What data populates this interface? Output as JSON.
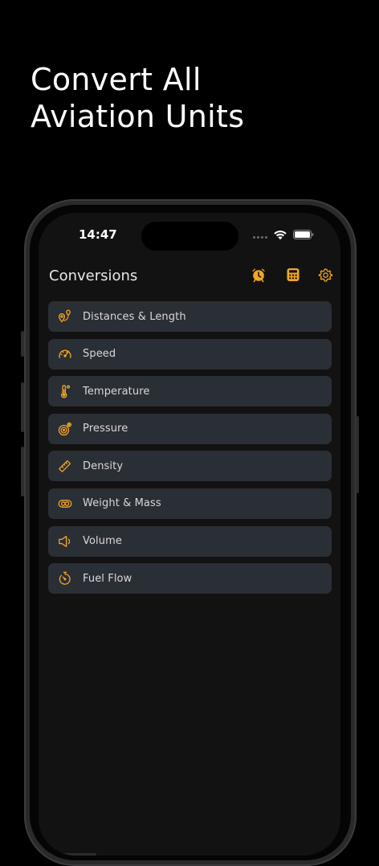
{
  "promo": {
    "headline_line1": "Convert All",
    "headline_line2": "Aviation Units"
  },
  "status_bar": {
    "time": "14:47",
    "icons": [
      "cellular-dots-icon",
      "wifi-icon",
      "battery-icon"
    ]
  },
  "nav": {
    "title": "Conversions",
    "actions": [
      {
        "name": "alarm-clock-icon"
      },
      {
        "name": "calculator-icon"
      },
      {
        "name": "gear-icon"
      }
    ]
  },
  "conversions": [
    {
      "label": "Distances & Length",
      "icon": "route-pin-icon"
    },
    {
      "label": "Speed",
      "icon": "speedometer-icon"
    },
    {
      "label": "Temperature",
      "icon": "thermometer-icon"
    },
    {
      "label": "Pressure",
      "icon": "pressure-gauge-icon"
    },
    {
      "label": "Density",
      "icon": "ruler-icon"
    },
    {
      "label": "Weight & Mass",
      "icon": "weight-coins-icon"
    },
    {
      "label": "Volume",
      "icon": "speaker-volume-icon"
    },
    {
      "label": "Fuel Flow",
      "icon": "stopwatch-icon"
    }
  ],
  "colors": {
    "accent": "#f5a623",
    "row_background": "#2a2e35",
    "screen_background": "#121212",
    "page_background": "#000000"
  }
}
